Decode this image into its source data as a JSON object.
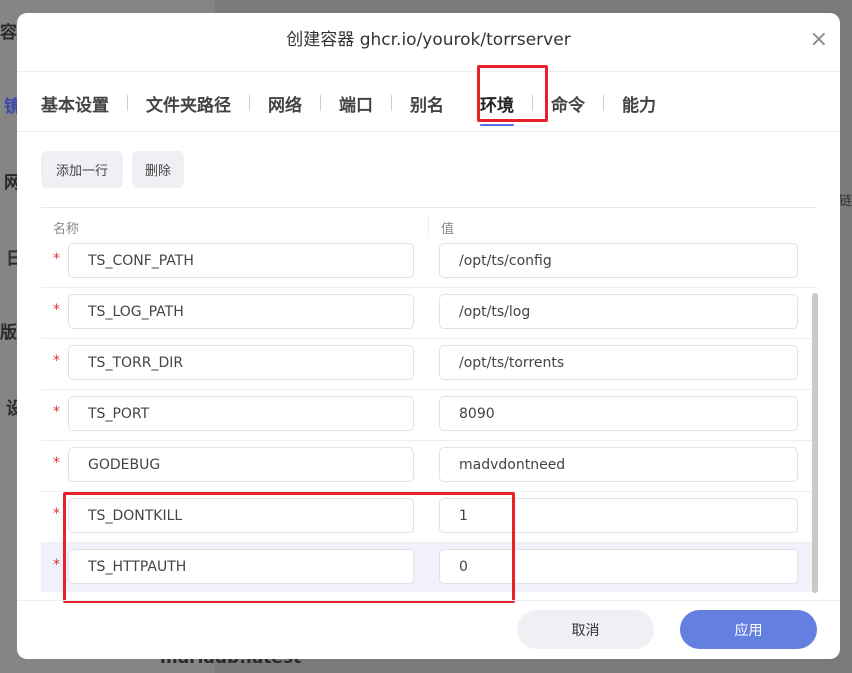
{
  "background": {
    "left": [
      "容器",
      "镜",
      "网",
      "日",
      "版本",
      "设"
    ],
    "bottom": "mariadb:latest",
    "right": "链"
  },
  "dialog": {
    "title": "创建容器 ghcr.io/yourok/torrserver",
    "close": "×"
  },
  "tabs": [
    "基本设置",
    "文件夹路径",
    "网络",
    "端口",
    "别名",
    "环境",
    "命令",
    "能力"
  ],
  "active_tab": "环境",
  "toolbar": {
    "add_row": "添加一行",
    "delete": "删除"
  },
  "table": {
    "headers": [
      "名称",
      "值"
    ],
    "rows": [
      {
        "name": "TS_CONF_PATH",
        "value": "/opt/ts/config"
      },
      {
        "name": "TS_LOG_PATH",
        "value": "/opt/ts/log"
      },
      {
        "name": "TS_TORR_DIR",
        "value": "/opt/ts/torrents"
      },
      {
        "name": "TS_PORT",
        "value": "8090"
      },
      {
        "name": "GODEBUG",
        "value": "madvdontneed"
      },
      {
        "name": "TS_DONTKILL",
        "value": "1"
      },
      {
        "name": "TS_HTTPAUTH",
        "value": "0"
      }
    ],
    "required_mark": "*"
  },
  "footer": {
    "cancel": "取消",
    "apply": "应用"
  },
  "colors": {
    "accent": "#6380e0",
    "highlight": "#e8202a"
  }
}
